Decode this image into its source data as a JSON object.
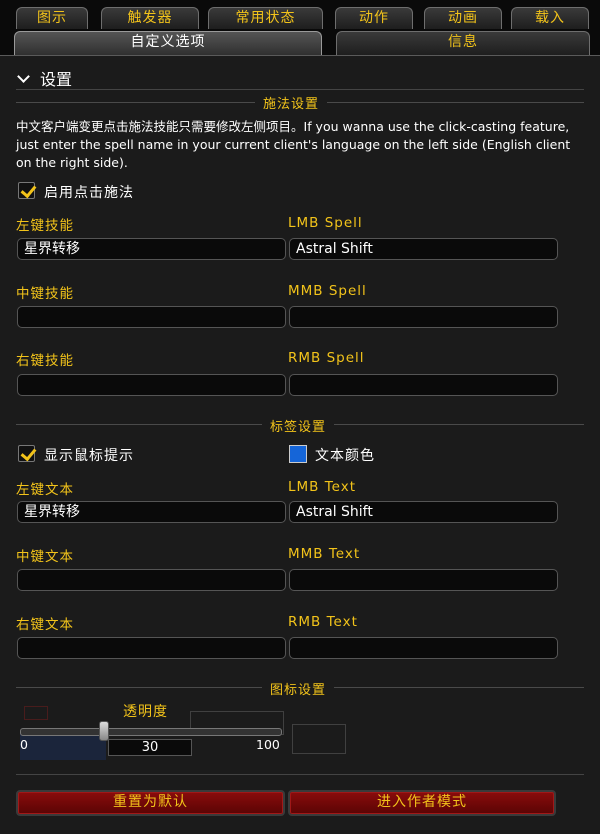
{
  "tabs_top": [
    {
      "label": "图示"
    },
    {
      "label": "触发器"
    },
    {
      "label": "常用状态"
    },
    {
      "label": "动作"
    },
    {
      "label": "动画"
    },
    {
      "label": "载入"
    }
  ],
  "tabs_second": [
    {
      "label": "自定义选项"
    },
    {
      "label": "信息"
    }
  ],
  "header": {
    "title": "设置"
  },
  "casting": {
    "section_title": "施法设置",
    "description": "中文客户端变更点击施法技能只需要修改左侧项目。If you wanna use the click-casting feature, just enter the spell name in your current client's language on the left side (English client on the right side).",
    "enable_label": "启用点击施法",
    "enable_checked": true,
    "left_label": "左键技能",
    "left_value": "星界转移",
    "lmb_label": "LMB Spell",
    "lmb_value": "Astral Shift",
    "mid_label": "中键技能",
    "mid_value": "",
    "mmb_label": "MMB Spell",
    "mmb_value": "",
    "right_label": "右键技能",
    "right_value": "",
    "rmb_label": "RMB Spell",
    "rmb_value": ""
  },
  "labels": {
    "section_title": "标签设置",
    "tooltip_label": "显示鼠标提示",
    "tooltip_checked": true,
    "text_color_label": "文本颜色",
    "text_color": "#1565d8",
    "left_label": "左键文本",
    "left_value": "星界转移",
    "lmb_label": "LMB Text",
    "lmb_value": "Astral Shift",
    "mid_label": "中键文本",
    "mid_value": "",
    "mmb_label": "MMB Text",
    "mmb_value": "",
    "right_label": "右键文本",
    "right_value": "",
    "rmb_label": "RMB Text",
    "rmb_value": ""
  },
  "icon_settings": {
    "section_title": "图标设置",
    "opacity_label": "透明度",
    "opacity_min": "0",
    "opacity_max": "100",
    "opacity_value": "30"
  },
  "buttons": {
    "reset": "重置为默认",
    "author_mode": "进入作者模式"
  },
  "colors": {
    "accent_gold": "#f2c31a",
    "button_red": "#8a0c0c",
    "panel_bg": "#1b1b1b"
  }
}
